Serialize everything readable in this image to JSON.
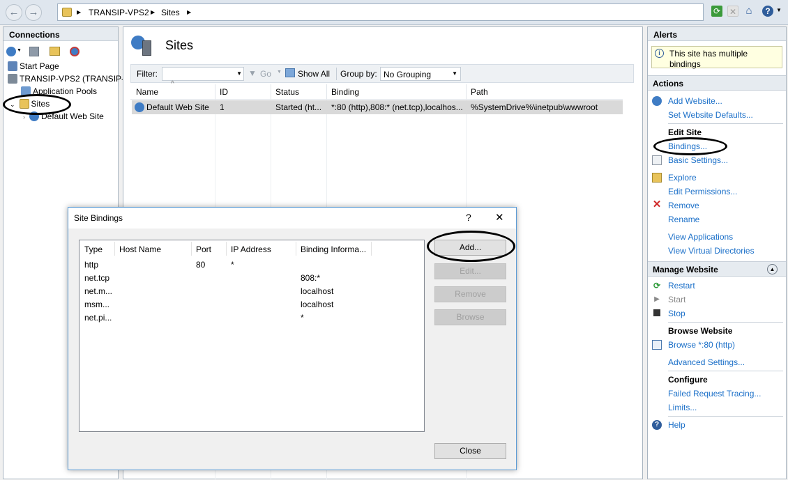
{
  "breadcrumb": {
    "items": [
      "TRANSIP-VPS2",
      "Sites"
    ]
  },
  "connections": {
    "title": "Connections",
    "tree": {
      "start_page": "Start Page",
      "server": "TRANSIP-VPS2 (TRANSIP-",
      "app_pools": "Application Pools",
      "sites": "Sites",
      "default_site": "Default Web Site"
    }
  },
  "center": {
    "title": "Sites",
    "filter": {
      "label": "Filter:",
      "value": "",
      "go_label": "Go",
      "show_all_label": "Show All",
      "group_by_label": "Group by:",
      "group_by_value": "No Grouping"
    },
    "columns": [
      "Name",
      "ID",
      "Status",
      "Binding",
      "Path"
    ],
    "rows": [
      {
        "name": "Default Web Site",
        "id": "1",
        "status": "Started (ht...",
        "binding": "*:80 (http),808:* (net.tcp),localhos...",
        "path": "%SystemDrive%\\inetpub\\wwwroot"
      }
    ]
  },
  "alerts": {
    "title": "Alerts",
    "message": "This site has multiple bindings"
  },
  "actions": {
    "title": "Actions",
    "add_website": "Add Website...",
    "set_defaults": "Set Website Defaults...",
    "edit_site_head": "Edit Site",
    "bindings": "Bindings...",
    "basic_settings": "Basic Settings...",
    "explore": "Explore",
    "edit_permissions": "Edit Permissions...",
    "remove": "Remove",
    "rename": "Rename",
    "view_applications": "View Applications",
    "view_virtual_dirs": "View Virtual Directories",
    "manage_head": "Manage Website",
    "restart": "Restart",
    "start": "Start",
    "stop": "Stop",
    "browse_head": "Browse Website",
    "browse": "Browse *:80 (http)",
    "advanced_settings": "Advanced Settings...",
    "configure_head": "Configure",
    "failed_request": "Failed Request Tracing...",
    "limits": "Limits...",
    "help": "Help"
  },
  "dialog": {
    "title": "Site Bindings",
    "help_glyph": "?",
    "close_glyph": "✕",
    "columns": [
      "Type",
      "Host Name",
      "Port",
      "IP Address",
      "Binding Informa..."
    ],
    "rows": [
      {
        "type": "http",
        "host": "",
        "port": "80",
        "ip": "*",
        "info": ""
      },
      {
        "type": "net.tcp",
        "host": "",
        "port": "",
        "ip": "",
        "info": "808:*"
      },
      {
        "type": "net.m...",
        "host": "",
        "port": "",
        "ip": "",
        "info": "localhost"
      },
      {
        "type": "msm...",
        "host": "",
        "port": "",
        "ip": "",
        "info": "localhost"
      },
      {
        "type": "net.pi...",
        "host": "",
        "port": "",
        "ip": "",
        "info": "*"
      }
    ],
    "buttons": {
      "add": "Add...",
      "edit": "Edit...",
      "remove": "Remove",
      "browse": "Browse",
      "close": "Close"
    }
  },
  "colors": {
    "link": "#1a6fc8",
    "header_bg": "#e6ebf0",
    "dialog_border": "#5b9bd5",
    "alert_bg": "#ffffe1"
  }
}
